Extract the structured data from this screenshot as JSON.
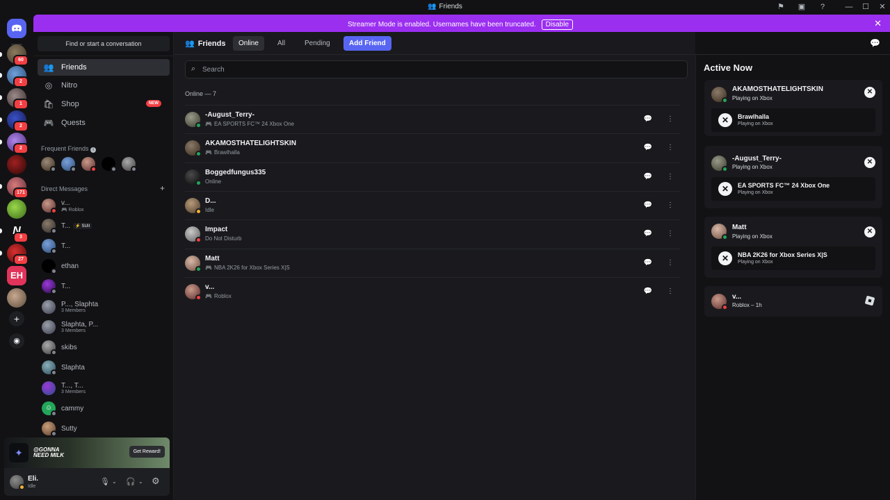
{
  "window": {
    "title": "Friends"
  },
  "banner": {
    "text": "Streamer Mode is enabled. Usernames have been truncated.",
    "button": "Disable"
  },
  "rail": {
    "badges": [
      "60",
      "2",
      "1",
      "2",
      "2",
      "171",
      "3",
      "27"
    ]
  },
  "sidebar": {
    "find_placeholder": "Find or start a conversation",
    "nav": [
      {
        "label": "Friends",
        "icon": "friends-icon"
      },
      {
        "label": "Nitro",
        "icon": "nitro-icon"
      },
      {
        "label": "Shop",
        "icon": "shop-icon",
        "badge": "NEW"
      },
      {
        "label": "Quests",
        "icon": "quests-icon"
      }
    ],
    "frequent_label": "Frequent Friends",
    "dm_label": "Direct Messages",
    "dms": [
      {
        "name": "v...",
        "sub": "Roblox",
        "status": "dnd"
      },
      {
        "name": "T...",
        "sub": "",
        "tag": "⚡ SUII",
        "status": "off"
      },
      {
        "name": "T...",
        "sub": "",
        "status": "off"
      },
      {
        "name": "ethan",
        "sub": "",
        "status": "off"
      },
      {
        "name": "T...",
        "sub": "",
        "status": "off"
      },
      {
        "name": "P..., Slaphta",
        "sub": "3 Members",
        "status": ""
      },
      {
        "name": "Slaphta, P...",
        "sub": "3 Members",
        "status": ""
      },
      {
        "name": "skibs",
        "sub": "",
        "status": "off"
      },
      {
        "name": "Slaphta",
        "sub": "",
        "status": "off"
      },
      {
        "name": "T..., T...",
        "sub": "3 Members",
        "status": ""
      },
      {
        "name": "cammy",
        "sub": "",
        "status": "off"
      },
      {
        "name": "Sutty",
        "sub": "",
        "status": "off"
      }
    ]
  },
  "reward": {
    "line1": "@GONNA",
    "line2": "NEED MILK",
    "button": "Get Reward!"
  },
  "user": {
    "name": "Eli.",
    "status": "Idle"
  },
  "main": {
    "title": "Friends",
    "tabs": [
      "Online",
      "All",
      "Pending"
    ],
    "add_friend": "Add Friend",
    "search_placeholder": "Search",
    "online_header": "Online — 7",
    "friends": [
      {
        "name": "-August_Terry-",
        "sub": "EA SPORTS FC™ 24 Xbox One",
        "status": "online",
        "gaming": true
      },
      {
        "name": "AKAMOSTHATELIGHTSKIN",
        "sub": "Brawlhalla",
        "status": "online",
        "gaming": true
      },
      {
        "name": "Boggedfungus335",
        "sub": "Online",
        "status": "online",
        "gaming": false
      },
      {
        "name": "D...",
        "sub": "Idle",
        "status": "idle",
        "gaming": false
      },
      {
        "name": "Impact",
        "sub": "Do Not Disturb",
        "status": "dnd",
        "gaming": false
      },
      {
        "name": "Matt",
        "sub": "NBA 2K26 for Xbox Series X|S",
        "status": "online",
        "gaming": true
      },
      {
        "name": "v...",
        "sub": "Roblox",
        "status": "dnd",
        "gaming": true
      }
    ]
  },
  "active_now": {
    "title": "Active Now",
    "cards": [
      {
        "name": "AKAMOSTHATELIGHTSKIN",
        "sub": "Playing on Xbox",
        "game": "Brawlhalla",
        "game_sub": "Playing on Xbox"
      },
      {
        "name": "-August_Terry-",
        "sub": "Playing on Xbox",
        "game": "EA SPORTS FC™ 24 Xbox One",
        "game_sub": "Playing on Xbox"
      },
      {
        "name": "Matt",
        "sub": "Playing on Xbox",
        "game": "NBA 2K26 for Xbox Series X|S",
        "game_sub": "Playing on Xbox"
      },
      {
        "name": "v...",
        "sub": "Roblox – 1h"
      }
    ]
  }
}
